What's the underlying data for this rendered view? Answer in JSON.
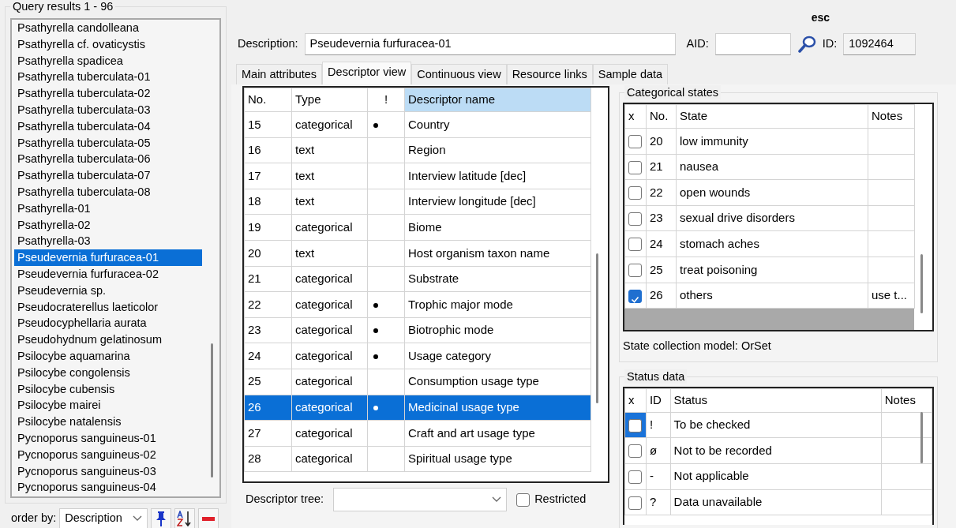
{
  "query_results": {
    "title": "Query results",
    "range": "1 - 96",
    "items": [
      {
        "label": "Psathyrella candolleana",
        "selected": false
      },
      {
        "label": "Psathyrella cf. ovaticystis",
        "selected": false
      },
      {
        "label": "Psathyrella spadicea",
        "selected": false
      },
      {
        "label": "Psathyrella tuberculata-01",
        "selected": false
      },
      {
        "label": "Psathyrella tuberculata-02",
        "selected": false
      },
      {
        "label": "Psathyrella tuberculata-03",
        "selected": false
      },
      {
        "label": "Psathyrella tuberculata-04",
        "selected": false
      },
      {
        "label": "Psathyrella tuberculata-05",
        "selected": false
      },
      {
        "label": "Psathyrella tuberculata-06",
        "selected": false
      },
      {
        "label": "Psathyrella tuberculata-07",
        "selected": false
      },
      {
        "label": "Psathyrella tuberculata-08",
        "selected": false
      },
      {
        "label": "Psathyrella-01",
        "selected": false
      },
      {
        "label": "Psathyrella-02",
        "selected": false
      },
      {
        "label": "Psathyrella-03",
        "selected": false
      },
      {
        "label": "Pseudevernia furfuracea-01",
        "selected": true
      },
      {
        "label": "Pseudevernia furfuracea-02",
        "selected": false
      },
      {
        "label": "Pseudevernia sp.",
        "selected": false
      },
      {
        "label": "Pseudocraterellus laeticolor",
        "selected": false
      },
      {
        "label": "Pseudocyphellaria aurata",
        "selected": false
      },
      {
        "label": "Pseudohydnum gelatinosum",
        "selected": false
      },
      {
        "label": "Psilocybe aquamarina",
        "selected": false
      },
      {
        "label": "Psilocybe congolensis",
        "selected": false
      },
      {
        "label": "Psilocybe cubensis",
        "selected": false
      },
      {
        "label": "Psilocybe mairei",
        "selected": false
      },
      {
        "label": "Psilocybe natalensis",
        "selected": false
      },
      {
        "label": "Pycnoporus sanguineus-01",
        "selected": false
      },
      {
        "label": "Pycnoporus sanguineus-02",
        "selected": false
      },
      {
        "label": "Pycnoporus sanguineus-03",
        "selected": false
      },
      {
        "label": "Pycnoporus sanguineus-04",
        "selected": false
      }
    ],
    "order_by": {
      "label": "order by:",
      "value": "Description"
    }
  },
  "shortcut_hint": "esc",
  "description": {
    "label": "Description:",
    "value": "Pseudevernia furfuracea-01"
  },
  "aid": {
    "label": "AID:"
  },
  "id": {
    "label": "ID:",
    "value": "1092464"
  },
  "tabs": [
    {
      "label": "Main attributes",
      "selected": false
    },
    {
      "label": "Descriptor view",
      "selected": true
    },
    {
      "label": "Continuous view",
      "selected": false
    },
    {
      "label": "Resource links",
      "selected": false
    },
    {
      "label": "Sample data",
      "selected": false
    }
  ],
  "descriptors": {
    "columns": [
      "No.",
      "Type",
      "!",
      "Descriptor name"
    ],
    "rows": [
      {
        "no": "15",
        "type": "categorical",
        "flagged": true,
        "name": "Country",
        "selected": false
      },
      {
        "no": "16",
        "type": "text",
        "flagged": false,
        "name": "Region",
        "selected": false
      },
      {
        "no": "17",
        "type": "text",
        "flagged": false,
        "name": "Interview latitude [dec]",
        "selected": false
      },
      {
        "no": "18",
        "type": "text",
        "flagged": false,
        "name": "Interview longitude [dec]",
        "selected": false
      },
      {
        "no": "19",
        "type": "categorical",
        "flagged": false,
        "name": "Biome",
        "selected": false
      },
      {
        "no": "20",
        "type": "text",
        "flagged": false,
        "name": "Host organism taxon name",
        "selected": false
      },
      {
        "no": "21",
        "type": "categorical",
        "flagged": false,
        "name": "Substrate",
        "selected": false
      },
      {
        "no": "22",
        "type": "categorical",
        "flagged": true,
        "name": "Trophic major mode",
        "selected": false
      },
      {
        "no": "23",
        "type": "categorical",
        "flagged": true,
        "name": "Biotrophic mode",
        "selected": false
      },
      {
        "no": "24",
        "type": "categorical",
        "flagged": true,
        "name": "Usage category",
        "selected": false
      },
      {
        "no": "25",
        "type": "categorical",
        "flagged": false,
        "name": "Consumption usage type",
        "selected": false
      },
      {
        "no": "26",
        "type": "categorical",
        "flagged": true,
        "name": "Medicinal usage type",
        "selected": true
      },
      {
        "no": "27",
        "type": "categorical",
        "flagged": false,
        "name": "Craft and art usage type",
        "selected": false
      },
      {
        "no": "28",
        "type": "categorical",
        "flagged": false,
        "name": "Spiritual usage type",
        "selected": false
      }
    ]
  },
  "descriptor_tree": {
    "label": "Descriptor tree:"
  },
  "restricted": {
    "label": "Restricted",
    "checked": false
  },
  "categorical_states": {
    "title": "Categorical states",
    "columns": [
      "x",
      "No.",
      "State",
      "Notes"
    ],
    "rows": [
      {
        "checked": false,
        "no": "20",
        "state": "low immunity"
      },
      {
        "checked": false,
        "no": "21",
        "state": "nausea"
      },
      {
        "checked": false,
        "no": "22",
        "state": "open wounds"
      },
      {
        "checked": false,
        "no": "23",
        "state": "sexual drive disorders"
      },
      {
        "checked": false,
        "no": "24",
        "state": "stomach aches"
      },
      {
        "checked": false,
        "no": "25",
        "state": "treat poisoning"
      },
      {
        "checked": true,
        "no": "26",
        "state": "others",
        "notes": "use t..."
      }
    ],
    "collection_model": {
      "label": "State collection model:",
      "value": "OrSet"
    }
  },
  "status_data": {
    "title": "Status data",
    "columns": [
      "x",
      "ID",
      "Status",
      "Notes"
    ],
    "rows": [
      {
        "checked": false,
        "selected": true,
        "id": "!",
        "status": "To be checked"
      },
      {
        "checked": false,
        "selected": false,
        "id": "ø",
        "status": "Not to be recorded"
      },
      {
        "checked": false,
        "selected": false,
        "id": "-",
        "status": "Not applicable"
      },
      {
        "checked": false,
        "selected": false,
        "id": "?",
        "status": "Data unavailable"
      }
    ]
  }
}
